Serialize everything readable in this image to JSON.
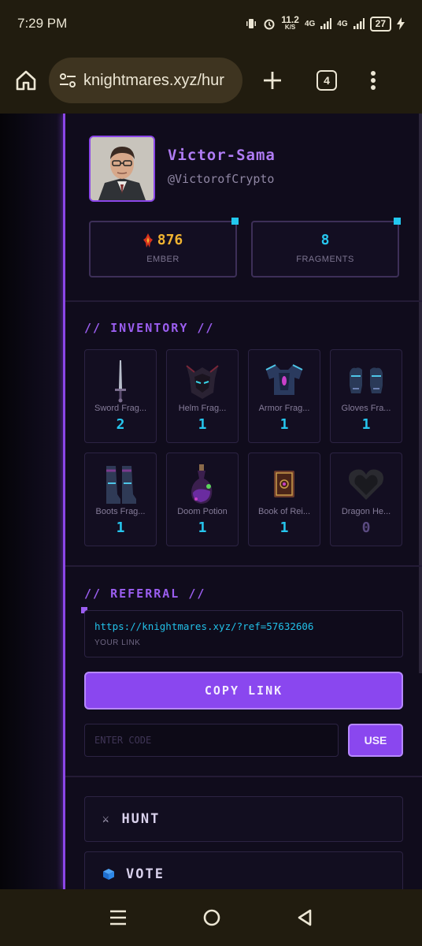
{
  "status_bar": {
    "time": "7:29 PM",
    "speed": "11.2",
    "speed_unit": "K/S",
    "net1": "4G",
    "net2": "4G",
    "battery": "27"
  },
  "browser": {
    "url": "knightmares.xyz/hur",
    "tab_count": "4"
  },
  "profile": {
    "name": "Victor-Sama",
    "handle": "@VictorofCrypto"
  },
  "stats": [
    {
      "value": "876",
      "label": "EMBER",
      "color": "#f0b331"
    },
    {
      "value": "8",
      "label": "FRAGMENTS",
      "color": "#26c6ee"
    }
  ],
  "inventory": {
    "heading": "// INVENTORY //",
    "items": [
      {
        "label": "Sword Frag...",
        "count": "2",
        "icon": "sword-icon"
      },
      {
        "label": "Helm Frag...",
        "count": "1",
        "icon": "helm-icon"
      },
      {
        "label": "Armor Frag...",
        "count": "1",
        "icon": "armor-icon"
      },
      {
        "label": "Gloves Fra...",
        "count": "1",
        "icon": "gloves-icon"
      },
      {
        "label": "Boots Frag...",
        "count": "1",
        "icon": "boots-icon"
      },
      {
        "label": "Doom Potion",
        "count": "1",
        "icon": "potion-icon"
      },
      {
        "label": "Book of Rei...",
        "count": "1",
        "icon": "book-icon"
      },
      {
        "label": "Dragon He...",
        "count": "0",
        "icon": "dragon-heart-icon"
      }
    ]
  },
  "referral": {
    "heading": "// REFERRAL //",
    "link": "https://knightmares.xyz/?ref=57632606",
    "link_caption": "YOUR LINK",
    "copy_label": "COPY LINK",
    "code_placeholder": "ENTER CODE",
    "use_label": "USE"
  },
  "nav": [
    {
      "label": "HUNT",
      "icon": "crossed-swords-icon"
    },
    {
      "label": "VOTE",
      "icon": "cube-icon"
    }
  ],
  "colors": {
    "accent": "#8a47ef",
    "cyan": "#26c6ee",
    "gold": "#f0b331",
    "background": "#100c1c"
  }
}
